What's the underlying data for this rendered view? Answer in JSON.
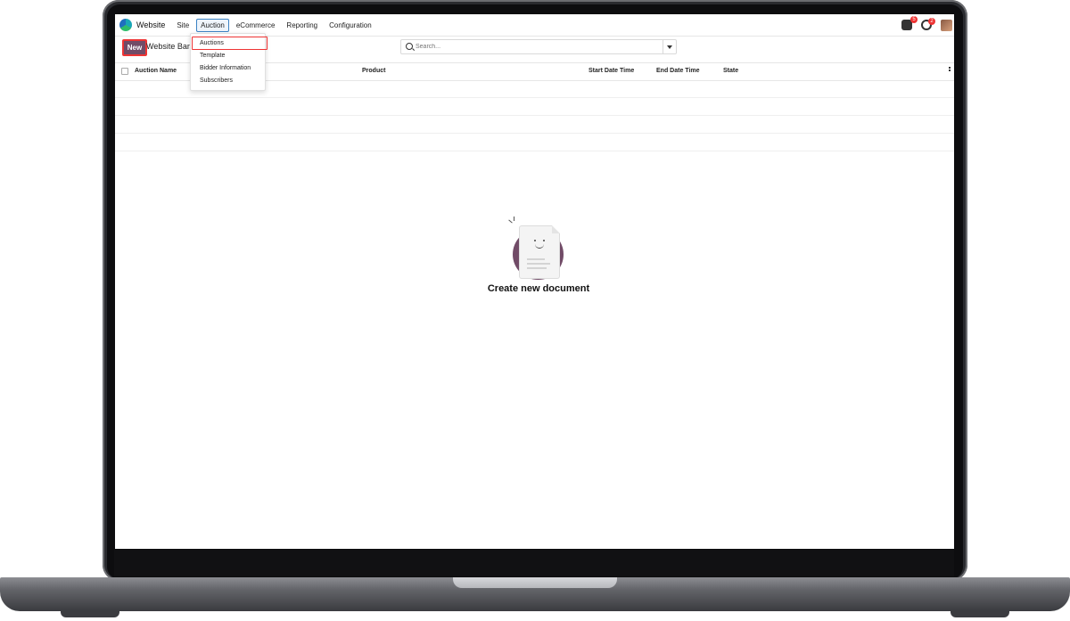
{
  "app": {
    "name": "Website"
  },
  "menu": {
    "items": [
      "Site",
      "Auction",
      "eCommerce",
      "Reporting",
      "Configuration"
    ],
    "active": "Auction"
  },
  "notifications": {
    "messages_badge": "5",
    "activities_badge": "2"
  },
  "control_panel": {
    "new_label": "New",
    "breadcrumb": "Website Bar"
  },
  "search": {
    "placeholder": "Search..."
  },
  "list": {
    "columns": [
      "Auction Name",
      "Product",
      "Start Date Time",
      "End Date Time",
      "State"
    ]
  },
  "auction_dropdown": {
    "items": [
      "Auctions",
      "Template",
      "Bidder Information",
      "Subscribers"
    ],
    "selected": "Auctions"
  },
  "empty_state": {
    "title": "Create new document"
  },
  "colors": {
    "brand": "#714b67",
    "highlight": "#e33333",
    "active_menu_border": "#3b82c4"
  }
}
